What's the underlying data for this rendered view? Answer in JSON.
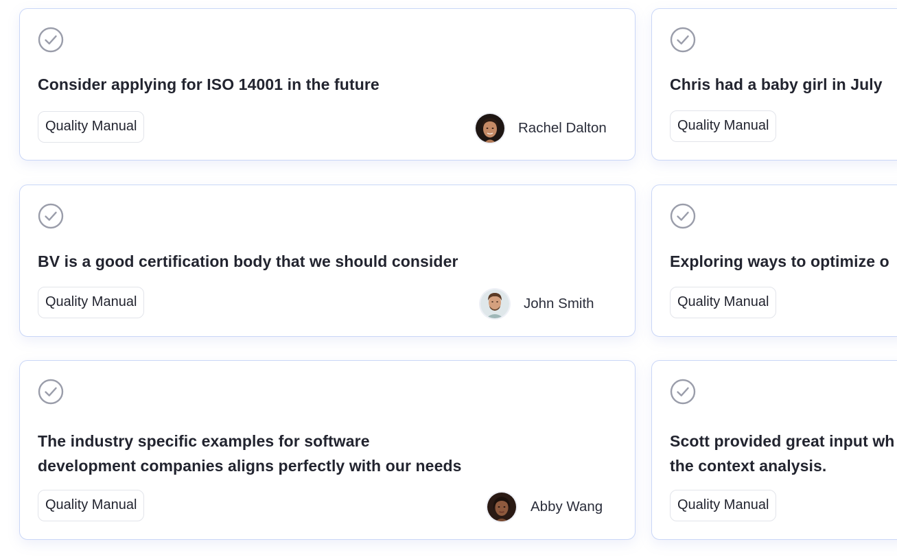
{
  "colors": {
    "card_border": "#c9d6f7",
    "check_icon": "#9a9daa",
    "title_text": "#22242f",
    "tag_border": "#e2e4ea"
  },
  "cards": [
    {
      "icon": "check-circle-icon",
      "title": "Consider applying for ISO 14001 in the future",
      "tag": "Quality Manual",
      "author": "Rachel Dalton"
    },
    {
      "icon": "check-circle-icon",
      "title": "Chris had a baby girl in July",
      "tag": "Quality Manual"
    },
    {
      "icon": "check-circle-icon",
      "title": "BV is a good certification body that we should consider",
      "tag": "Quality Manual",
      "author": "John Smith"
    },
    {
      "icon": "check-circle-icon",
      "title": "Exploring ways to optimize o",
      "tag": "Quality Manual"
    },
    {
      "icon": "check-circle-icon",
      "title_lines": [
        "The industry specific examples for software",
        "development companies aligns perfectly with our needs"
      ],
      "tag": "Quality Manual",
      "author": "Abby Wang"
    },
    {
      "icon": "check-circle-icon",
      "title_lines": [
        "Scott provided great input wh",
        "the context analysis."
      ],
      "tag": "Quality Manual"
    }
  ]
}
